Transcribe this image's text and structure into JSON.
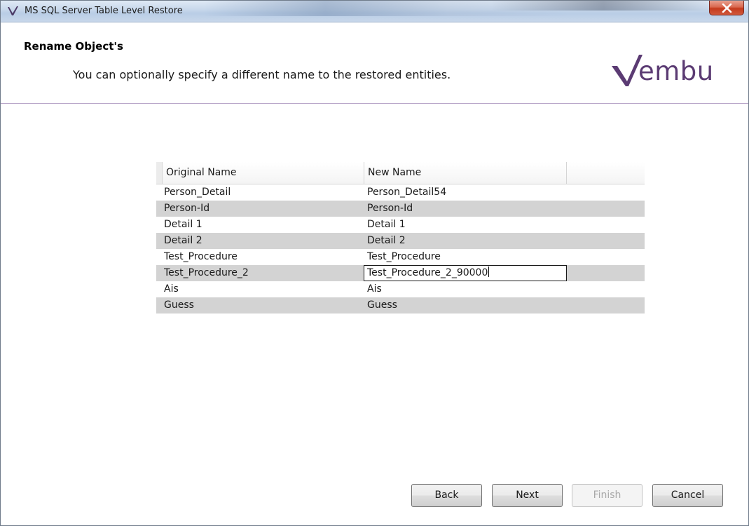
{
  "window": {
    "title": "MS SQL Server Table Level Restore",
    "close_icon": "close-icon"
  },
  "header": {
    "title": "Rename Object's",
    "subtitle": "You can optionally specify a different name to the restored entities.",
    "brand": "embu",
    "brand_color": "#5b3b73"
  },
  "grid": {
    "columns": [
      "Original Name",
      "New Name",
      ""
    ],
    "rows": [
      {
        "original": "Person_Detail",
        "new": "Person_Detail54"
      },
      {
        "original": "Person-Id",
        "new": "Person-Id"
      },
      {
        "original": "Detail 1",
        "new": "Detail 1"
      },
      {
        "original": "Detail 2",
        "new": "Detail 2"
      },
      {
        "original": "Test_Procedure",
        "new": "Test_Procedure"
      },
      {
        "original": "Test_Procedure_2",
        "new": "Test_Procedure_2_90000"
      },
      {
        "original": "Ais",
        "new": "Ais"
      },
      {
        "original": "Guess",
        "new": "Guess"
      }
    ]
  },
  "buttons": {
    "back": "Back",
    "next": "Next",
    "finish": "Finish",
    "cancel": "Cancel"
  }
}
